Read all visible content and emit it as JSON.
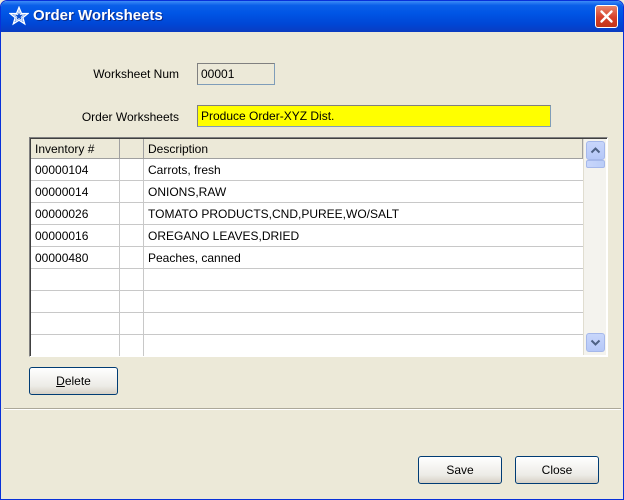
{
  "window": {
    "title": "Order Worksheets",
    "icon": "star-outline-icon"
  },
  "form": {
    "worksheet_num_label": "Worksheet Num",
    "worksheet_num_value": "00001",
    "order_worksheets_label": "Order Worksheets",
    "order_worksheets_value": "Produce Order-XYZ Dist.",
    "highlight_color": "#ffff00"
  },
  "grid": {
    "columns": [
      "Inventory #",
      "",
      "Description"
    ],
    "rows": [
      {
        "inventory": "00000104",
        "flag": "",
        "description": "Carrots, fresh"
      },
      {
        "inventory": "00000014",
        "flag": "",
        "description": "ONIONS,RAW"
      },
      {
        "inventory": "00000026",
        "flag": "",
        "description": "TOMATO PRODUCTS,CND,PUREE,WO/SALT"
      },
      {
        "inventory": "00000016",
        "flag": "",
        "description": "OREGANO LEAVES,DRIED"
      },
      {
        "inventory": "00000480",
        "flag": "",
        "description": "Peaches, canned"
      },
      {
        "inventory": "",
        "flag": "",
        "description": ""
      },
      {
        "inventory": "",
        "flag": "",
        "description": ""
      },
      {
        "inventory": "",
        "flag": "",
        "description": ""
      },
      {
        "inventory": "",
        "flag": "",
        "description": ""
      }
    ]
  },
  "buttons": {
    "delete": "Delete",
    "save": "Save",
    "close": "Close"
  }
}
